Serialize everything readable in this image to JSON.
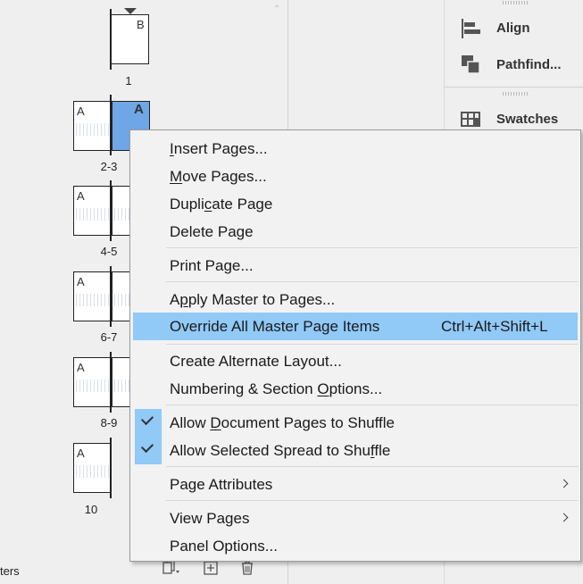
{
  "pages_panel": {
    "spreads": [
      {
        "label": "1",
        "left_master": "",
        "right_master": "B"
      },
      {
        "label": "2-3",
        "left_master": "A",
        "right_master": "A"
      },
      {
        "label": "4-5",
        "left_master": "A",
        "right_master": ""
      },
      {
        "label": "6-7",
        "left_master": "A",
        "right_master": ""
      },
      {
        "label": "8-9",
        "left_master": "A",
        "right_master": ""
      },
      {
        "label": "10",
        "left_master": "A",
        "right_master": ""
      }
    ],
    "status_label": "ters",
    "footer_icons": [
      "edit-page-size-icon",
      "new-page-icon",
      "delete-page-icon"
    ]
  },
  "dock": {
    "items": [
      {
        "label": "Align",
        "icon": "align-icon"
      },
      {
        "label": "Pathfind...",
        "icon": "pathfinder-icon"
      },
      {
        "label": "Swatches",
        "icon": "swatches-icon"
      }
    ]
  },
  "context_menu": {
    "items": [
      {
        "pre": "",
        "u": "I",
        "post": "nsert Pages..."
      },
      {
        "pre": "",
        "u": "M",
        "post": "ove Pages..."
      },
      {
        "pre": "Dupli",
        "u": "c",
        "post": "ate Page"
      },
      {
        "pre": "Delete Page",
        "u": "",
        "post": ""
      },
      {
        "pre": "Print Page...",
        "u": "",
        "post": ""
      },
      {
        "pre": "A",
        "u": "p",
        "post": "ply Master to Pages..."
      },
      {
        "pre": "Override All Master Page Items",
        "u": "",
        "post": "",
        "shortcut": "Ctrl+Alt+Shift+L"
      },
      {
        "pre": "Create Alternate Layout...",
        "u": "",
        "post": ""
      },
      {
        "pre": "Numbering & Section ",
        "u": "O",
        "post": "ptions..."
      },
      {
        "pre": "Allow ",
        "u": "D",
        "post": "ocument Pages to Shuffle"
      },
      {
        "pre": "Allow Selected Spread to Shu",
        "u": "f",
        "post": "fle"
      },
      {
        "pre": "Page Attributes",
        "u": "",
        "post": ""
      },
      {
        "pre": "View Pages",
        "u": "",
        "post": ""
      },
      {
        "pre": "Panel Options...",
        "u": "",
        "post": ""
      }
    ]
  },
  "colors": {
    "highlight": "#91c9f7",
    "selected_page": "#6fa7e6"
  }
}
